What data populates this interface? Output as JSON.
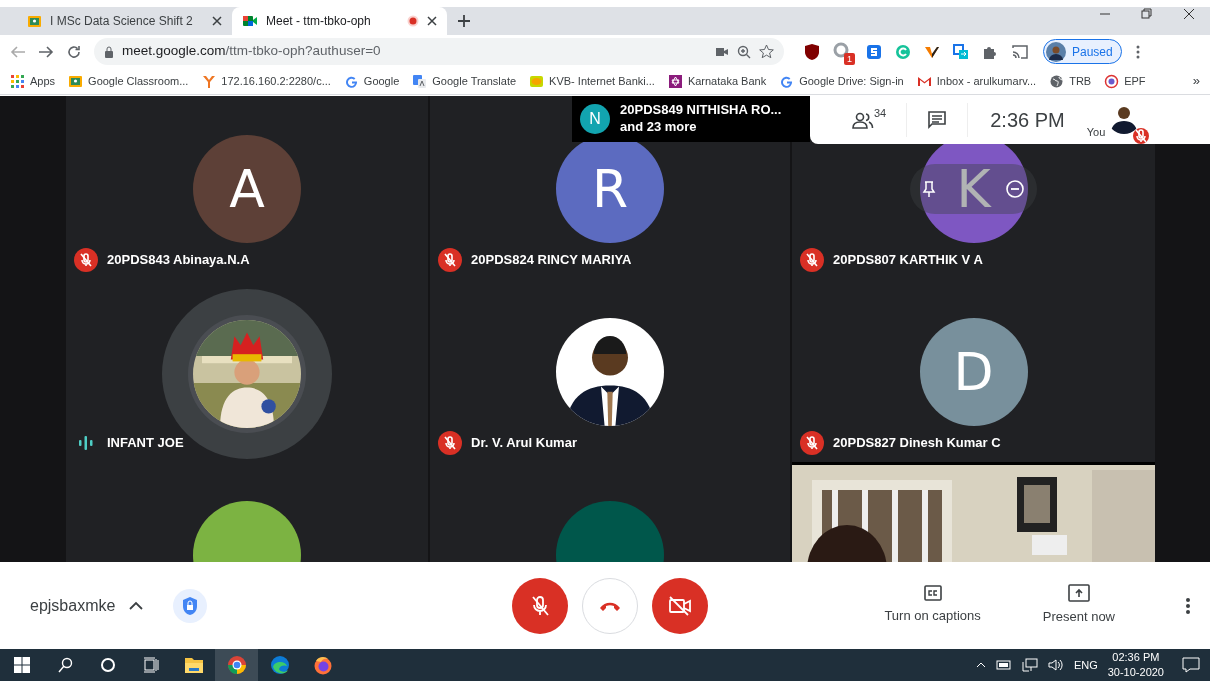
{
  "browser": {
    "tabs": [
      {
        "title": "I MSc Data Science Shift 2",
        "kind": "classroom",
        "selected": false,
        "recording": false
      },
      {
        "title": "Meet - ttm-tbko-oph",
        "kind": "meet",
        "selected": true,
        "recording": true
      }
    ],
    "address": {
      "host": "meet.google.com",
      "path": "/ttm-tbko-oph?authuser=0"
    },
    "extensions": [
      {
        "kind": "ublock"
      },
      {
        "kind": "badge-ext",
        "badge": "1"
      },
      {
        "kind": "s-ext"
      },
      {
        "kind": "grammar"
      },
      {
        "kind": "v-ext"
      },
      {
        "kind": "share-ext"
      },
      {
        "kind": "puzzle"
      },
      {
        "kind": "cast"
      }
    ],
    "profile": {
      "label": "Paused"
    },
    "bookmarks": [
      {
        "label": "Apps",
        "kind": "apps"
      },
      {
        "label": "Google Classroom...",
        "kind": "classroom"
      },
      {
        "label": "172.16.160.2:2280/c...",
        "kind": "fork"
      },
      {
        "label": "Google",
        "kind": "google"
      },
      {
        "label": "Google Translate",
        "kind": "translate"
      },
      {
        "label": "KVB- Internet Banki...",
        "kind": "kvb"
      },
      {
        "label": "Karnataka Bank",
        "kind": "star"
      },
      {
        "label": "Google Drive: Sign-in",
        "kind": "google"
      },
      {
        "label": "Inbox - arulkumarv...",
        "kind": "gmail"
      },
      {
        "label": "TRB",
        "kind": "globe"
      },
      {
        "label": "EPF",
        "kind": "epf"
      }
    ],
    "bookmarks_more": "»"
  },
  "meeting": {
    "tiles": [
      {
        "name": "20PDS843 Abinaya.N.A",
        "muted": true,
        "avatar": {
          "kind": "letter",
          "letter": "A",
          "color": "#5d4037"
        }
      },
      {
        "name": "20PDS824 RINCY MARIYA",
        "muted": true,
        "avatar": {
          "kind": "letter",
          "letter": "R",
          "color": "#5c6bc0"
        }
      },
      {
        "name": "20PDS807 KARTHIK V A",
        "muted": true,
        "hover": true,
        "avatar": {
          "kind": "letter",
          "letter": "K",
          "color": "#7e57c2"
        }
      },
      {
        "name": "INFANT JOE",
        "muted": false
      },
      {
        "name": "Dr. V. Arul Kumar",
        "muted": true,
        "avatar": {
          "kind": "person"
        }
      },
      {
        "name": "20PDS827 Dinesh Kumar C",
        "muted": true,
        "avatar": {
          "kind": "letter",
          "letter": "D",
          "color": "#78909c"
        }
      },
      {
        "avatar": {
          "kind": "blank",
          "color": "#7cb342"
        }
      },
      {
        "avatar": {
          "kind": "blank",
          "color": "#00574b"
        }
      },
      {
        "avatar": {
          "kind": "video"
        }
      }
    ],
    "join_notice": {
      "initial": "N",
      "color": "#12a4af",
      "name": "20PDS849 NITHISHA RO...",
      "more": "and 23 more"
    },
    "participants_count": "34",
    "time": "2:36 PM",
    "self_label": "You",
    "self_muted": true
  },
  "controls": {
    "meeting_code": "epjsbaxmke",
    "mic_on": false,
    "camera_on": false,
    "actions": [
      {
        "label": "Turn on captions",
        "kind": "captions"
      },
      {
        "label": "Present now",
        "kind": "present"
      }
    ]
  },
  "taskbar": {
    "apps": [
      {
        "kind": "explorer",
        "selected": false
      },
      {
        "kind": "chrome",
        "selected": true
      },
      {
        "kind": "edge",
        "selected": false
      },
      {
        "kind": "firefox",
        "selected": false
      }
    ],
    "language": "ENG",
    "time": "02:36 PM",
    "date": "30-10-2020"
  }
}
